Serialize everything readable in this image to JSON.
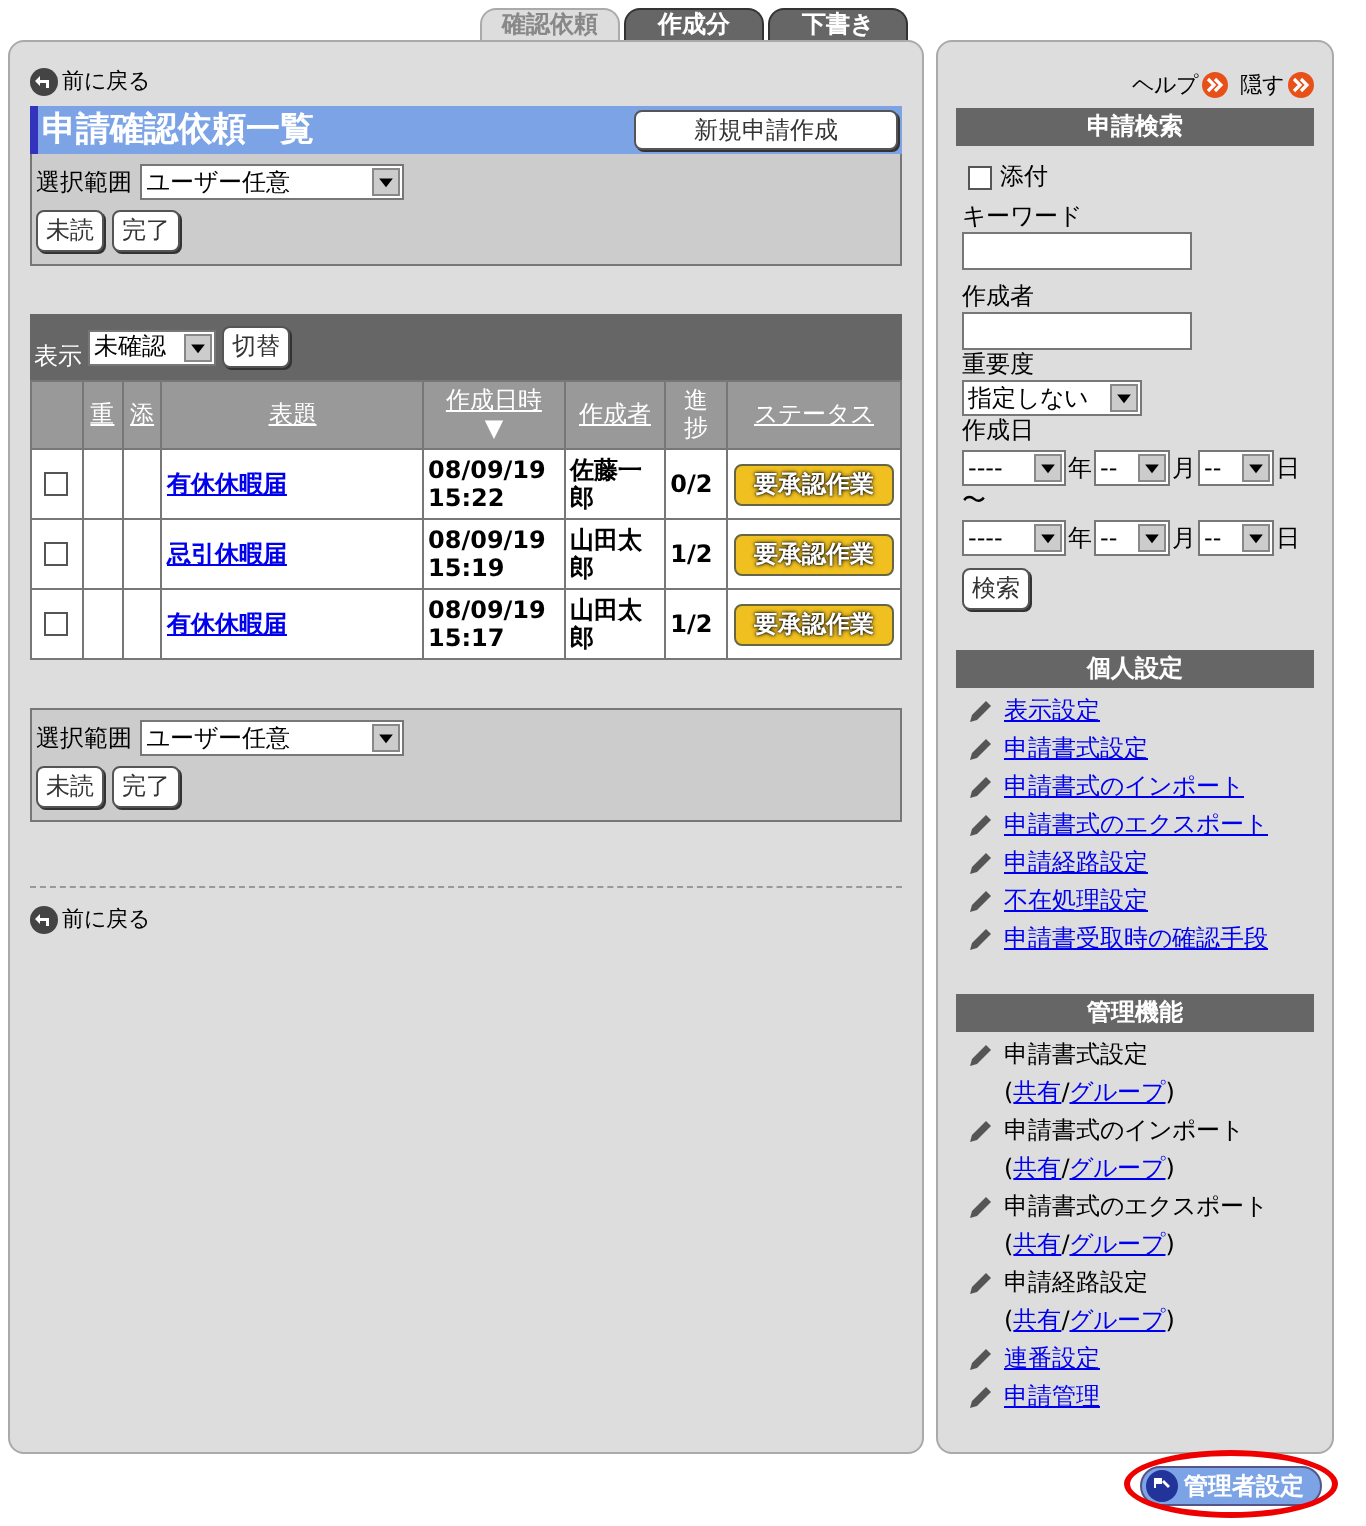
{
  "tabs": [
    {
      "label": "確認依頼",
      "selected": true
    },
    {
      "label": "作成分",
      "selected": false
    },
    {
      "label": "下書き",
      "selected": false
    }
  ],
  "back_links": [
    "前に戻る",
    "前に戻る"
  ],
  "title": "申請確認依頼一覧",
  "new_button": "新規申請作成",
  "filters": [
    {
      "label": "選択範囲",
      "value": "ユーザー任意",
      "buttons": [
        "未読",
        "完了"
      ]
    },
    {
      "label": "選択範囲",
      "value": "ユーザー任意",
      "buttons": [
        "未読",
        "完了"
      ]
    }
  ],
  "display": {
    "label": "表示",
    "value": "未確認",
    "button": "切替"
  },
  "table": {
    "columns": [
      {
        "label": "重",
        "link": true
      },
      {
        "label": "添",
        "link": true
      },
      {
        "label": "表題",
        "link": true
      },
      {
        "label": "作成日時",
        "link": true,
        "sort_mark": "▼"
      },
      {
        "label": "作成者",
        "link": true
      },
      {
        "label": "進捗",
        "link": false
      },
      {
        "label": "ステータス",
        "link": true
      }
    ],
    "rows": [
      {
        "checked": false,
        "title": "有休休暇届",
        "datetime": "08/09/19 15:22",
        "author": "佐藤一郎",
        "progress": "0/2",
        "status": "要承認作業"
      },
      {
        "checked": false,
        "title": "忌引休暇届",
        "datetime": "08/09/19 15:19",
        "author": "山田太郎",
        "progress": "1/2",
        "status": "要承認作業"
      },
      {
        "checked": false,
        "title": "有休休暇届",
        "datetime": "08/09/19 15:17",
        "author": "山田太郎",
        "progress": "1/2",
        "status": "要承認作業"
      }
    ]
  },
  "sidebar": {
    "help": "ヘルプ",
    "hide": "隠す",
    "search": {
      "title": "申請検索",
      "attachment": {
        "label": "添付",
        "checked": false
      },
      "keyword_label": "キーワード",
      "author_label": "作成者",
      "importance": {
        "label": "重要度",
        "value": "指定しない"
      },
      "date_label": "作成日",
      "date_rows": [
        {
          "year": "----",
          "year_unit": "年",
          "month": "--",
          "month_unit": "月",
          "day": "--",
          "day_unit": "日"
        },
        {
          "year": "----",
          "year_unit": "年",
          "month": "--",
          "month_unit": "月",
          "day": "--",
          "day_unit": "日"
        }
      ],
      "range_mark": "〜",
      "button": "検索"
    },
    "personal": {
      "title": "個人設定",
      "links": [
        "表示設定",
        "申請書式設定",
        "申請書式のインポート",
        "申請書式のエクスポート",
        "申請経路設定",
        "不在処理設定",
        "申請書受取時の確認手段"
      ]
    },
    "admin": {
      "title": "管理機能",
      "items": [
        {
          "kind": "scoped",
          "label": "申請書式設定",
          "open": "(",
          "links": [
            "共有",
            "グループ"
          ],
          "separator": "/",
          "close": ")"
        },
        {
          "kind": "scoped",
          "label": "申請書式のインポート",
          "open": "(",
          "links": [
            "共有",
            "グループ"
          ],
          "separator": "/",
          "close": ")"
        },
        {
          "kind": "scoped",
          "label": "申請書式のエクスポート",
          "open": "(",
          "links": [
            "共有",
            "グループ"
          ],
          "separator": "/",
          "close": ")"
        },
        {
          "kind": "scoped",
          "label": "申請経路設定",
          "open": "(",
          "links": [
            "共有",
            "グループ"
          ],
          "separator": "/",
          "close": ")"
        },
        {
          "kind": "link",
          "label": "連番設定"
        },
        {
          "kind": "link",
          "label": "申請管理"
        }
      ]
    }
  },
  "admin_button": {
    "label": "管理者設定",
    "highlighted": true
  }
}
